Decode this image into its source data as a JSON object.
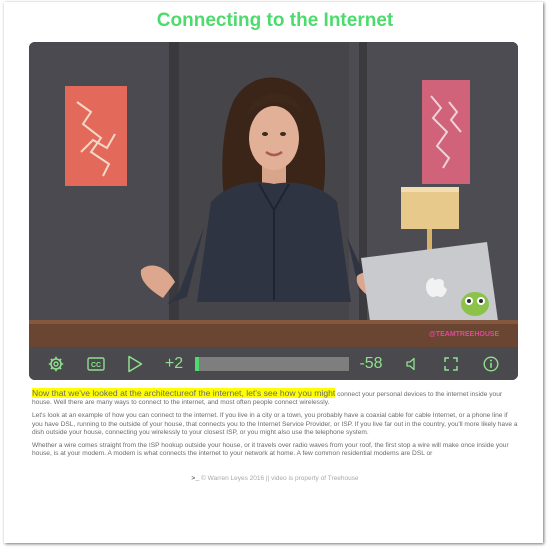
{
  "page": {
    "title": "Connecting to the Internet"
  },
  "video": {
    "watermark": "@TEAMTREEHOUSE",
    "controls": {
      "skip_forward_label": "+2",
      "time_remaining_label": "-58",
      "progress_fraction": 0.02
    }
  },
  "transcript": {
    "highlighted": "Now that we've looked at the architectureof the internet, let's see how you might",
    "p1_rest": " connect your personal devices to the internet inside your house. Well there are many ways to connect to the internet, and most often people connect wirelessly.",
    "p2": "Let's look at an example of how you can connect to the internet. If you live in a city or a town, you probably have a coaxial cable for cable Internet, or a phone line if you have DSL, running to the outside of your house, that connects you to the Internet Service Provider, or ISP. If you live far out in the country, you'll more likely have a dish outside your house, connecting you wirelessly to your closest ISP, or you might also use the telephone system.",
    "p3": "Whether a wire comes straight from the ISP hookup outside your house, or it travels over radio waves from your roof, the first stop a wire will make once inside your house, is at your modem. A modem is what connects the internet to your network at home. A few common residential modems are DSL or"
  },
  "footer": {
    "prompt": ">_",
    "text": " © Warren Leyes 2016 || video is property of Treehouse"
  },
  "colors": {
    "accent_green": "#4ddb6e",
    "control_bar": "#4a4a4e",
    "highlight": "#ffff00"
  },
  "icons": [
    "settings-icon",
    "closed-captions-icon",
    "play-icon",
    "volume-icon",
    "fullscreen-icon",
    "info-icon"
  ]
}
